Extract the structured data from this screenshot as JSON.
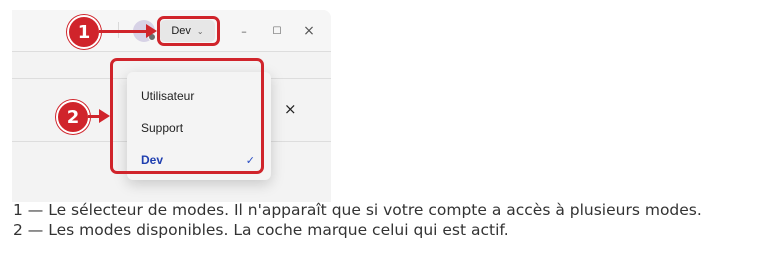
{
  "titlebar": {
    "mode_button_label": "Dev",
    "mode_button_chevron": "⌄",
    "minimize_glyph": "–",
    "maximize_glyph": "☐",
    "close_glyph": "×"
  },
  "panel": {
    "close_glyph": "×"
  },
  "mode_menu": {
    "items": [
      {
        "label": "Utilisateur",
        "selected": false
      },
      {
        "label": "Support",
        "selected": false
      },
      {
        "label": "Dev",
        "selected": true
      }
    ],
    "check_glyph": "✓"
  },
  "annotations": [
    {
      "number": "1",
      "text": "1 — Le sélecteur de modes. Il n'apparaît que si votre compte a accès à plusieurs modes."
    },
    {
      "number": "2",
      "text": "2 — Les modes disponibles. La coche marque celui qui est actif."
    }
  ],
  "colors": {
    "callout_red": "#d0242b",
    "active_mode_blue": "#1f3fb0"
  }
}
